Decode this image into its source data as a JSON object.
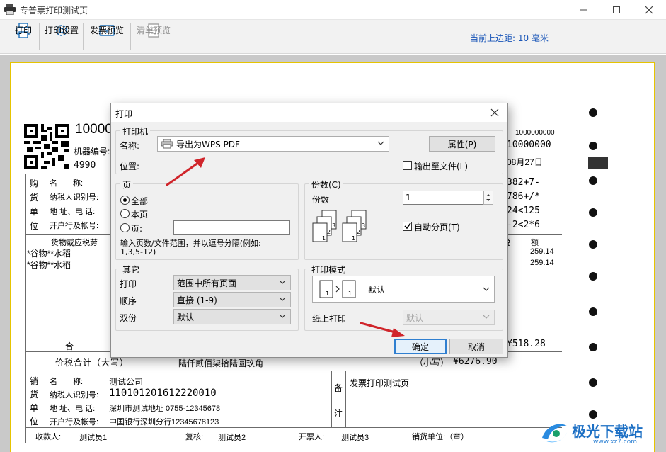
{
  "window": {
    "title": "专普票打印测试页",
    "minimize_icon": "minimize-icon",
    "maximize_icon": "maximize-icon",
    "close_icon": "close-icon"
  },
  "toolbar": {
    "print_label": "打印",
    "print_settings_label": "打印设置",
    "invoice_preview_label": "发票预览",
    "list_preview_label": "清单预览",
    "margin_info": "当前上边距: 10 毫米"
  },
  "invoice": {
    "code_prefix": "10000",
    "right_number": "1000000000",
    "right_number2": "10000000",
    "machine_label": "机器编号:",
    "machine_val": "4990",
    "date_tail": "08月27日",
    "buyer_side": [
      "购",
      "货",
      "单",
      "位"
    ],
    "buyer_rows": [
      "名　　称:",
      "纳税人识别号:",
      "地 址、电 话:",
      "开户行及帐号:"
    ],
    "cipher_rows": [
      "382+7-",
      "786+/*",
      "24<125",
      "-2<2*6"
    ],
    "goods_header": "货物或应税劳",
    "tax_header": "税",
    "amount_header": "额",
    "goods_items": [
      "*谷物**水稻",
      "*谷物**水稻"
    ],
    "tax_values": [
      "259.14",
      "259.14"
    ],
    "total_label": "合",
    "total_tax": "¥518.28",
    "price_tax_label": "价税合计（大写）",
    "price_tax_upper": "陆仟贰佰柒拾陆圆玖角",
    "small_label": "（小写）",
    "small_value": "¥6276.90",
    "seller_side": [
      "销",
      "货",
      "单",
      "位"
    ],
    "seller_name_label": "名　　称:",
    "seller_name": "测试公司",
    "seller_taxid_label": "纳税人识别号:",
    "seller_taxid": "110101201612220010",
    "seller_addr_label": "地 址、电 话:",
    "seller_addr": "深圳市测试地址 0755-12345678",
    "seller_bank_label": "开户行及帐号:",
    "seller_bank": "中国银行深圳分行12345678123",
    "remark_side": [
      "备",
      "注"
    ],
    "remark": "发票打印测试页",
    "payee_label": "收款人:",
    "payee": "测试员1",
    "reviewer_label": "复核:",
    "reviewer": "测试员2",
    "drawer_label": "开票人:",
    "drawer": "测试员3",
    "seller_unit_label": "销货单位:（章）"
  },
  "dialog": {
    "title": "打印",
    "printer_group": "打印机",
    "name_label": "名称:",
    "printer_name": "导出为WPS PDF",
    "properties_btn": "属性(P)",
    "location_label": "位置:",
    "print_to_file": "输出至文件(L)",
    "pages_group": "页",
    "all_label": "全部",
    "current_page_label": "本页",
    "pages_label": "页:",
    "pages_value": "",
    "pages_hint_line1": "输入页数/文件范围，并以逗号分隔(例如:",
    "pages_hint_line2": "1,3,5-12)",
    "copies_group": "份数(C)",
    "copies_label": "份数",
    "copies_value": "1",
    "collate_label": "自动分页(T)",
    "other_group": "其它",
    "print_label": "打印",
    "print_value": "范围中所有页面",
    "order_label": "顺序",
    "order_value": "直接 (1-9)",
    "duplex_label": "双份",
    "duplex_value": "默认",
    "mode_group": "打印模式",
    "mode_value": "默认",
    "paper_print_label": "纸上打印",
    "paper_print_value": "默认",
    "ok_btn": "确定",
    "cancel_btn": "取消"
  },
  "watermark": {
    "text": "极光下载站",
    "url": "www.xz7.com"
  }
}
